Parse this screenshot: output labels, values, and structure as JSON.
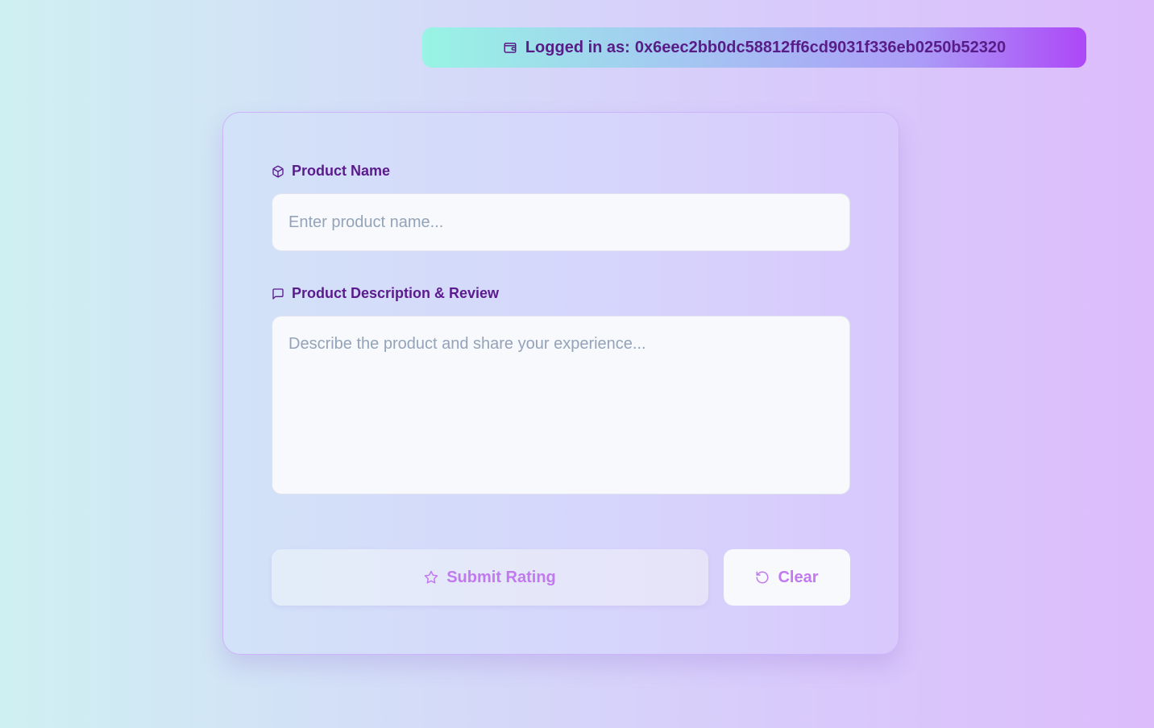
{
  "header": {
    "wallet_label": "Logged in as:",
    "wallet_address": "0x6eec2bb0dc58812ff6cd9031f336eb0250b52320",
    "wallet_icon": "wallet-icon"
  },
  "form": {
    "product_name": {
      "label": "Product Name",
      "icon": "package-icon",
      "value": "",
      "placeholder": "Enter product name..."
    },
    "description": {
      "label": "Product Description & Review",
      "icon": "message-square-icon",
      "value": "",
      "placeholder": "Describe the product and share your experience..."
    },
    "submit_label": "Submit Rating",
    "submit_icon": "star-icon",
    "clear_label": "Clear",
    "clear_icon": "rotate-ccw-icon"
  },
  "colors": {
    "label_text": "#5b1a8e",
    "button_text": "#c279f0",
    "badge_gradient_start": "#98f4e4",
    "badge_gradient_end": "#ad48f7"
  }
}
